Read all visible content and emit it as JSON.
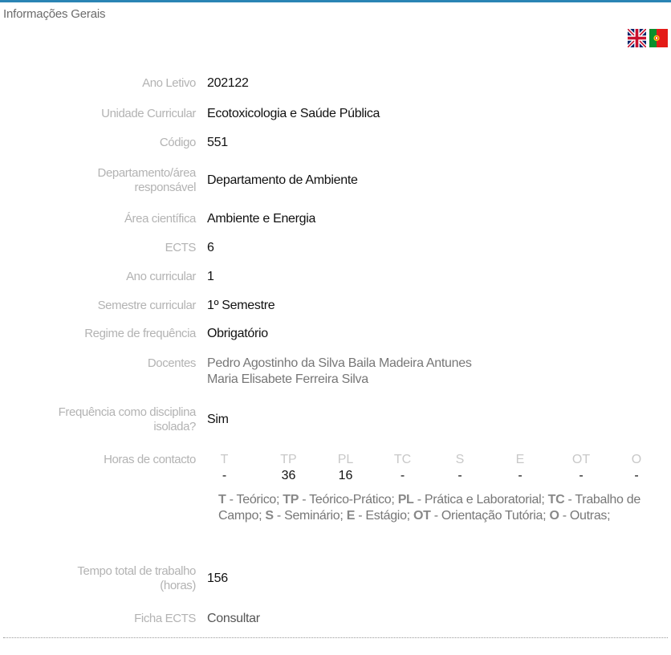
{
  "section_title": "Informações Gerais",
  "languages": [
    {
      "icon": "uk-flag-icon"
    },
    {
      "icon": "portugal-flag-icon"
    }
  ],
  "fields": {
    "ano_letivo": {
      "label": "Ano Letivo",
      "value": "202122"
    },
    "unidade_curricular": {
      "label": "Unidade Curricular",
      "value": "Ecotoxicologia e Saúde Pública"
    },
    "codigo": {
      "label": "Código",
      "value": "551"
    },
    "departamento": {
      "label_line1": "Departamento/área",
      "label_line2": "responsável",
      "value": "Departamento de Ambiente"
    },
    "area_cientifica": {
      "label": "Área científica",
      "value": "Ambiente e Energia"
    },
    "ects": {
      "label": "ECTS",
      "value": "6"
    },
    "ano_curricular": {
      "label": "Ano curricular",
      "value": "1"
    },
    "semestre": {
      "label": "Semestre curricular",
      "value": "1º Semestre"
    },
    "regime": {
      "label": "Regime de frequência",
      "value": "Obrigatório"
    },
    "docentes": {
      "label": "Docentes",
      "values": [
        "Pedro Agostinho da Silva Baila Madeira Antunes",
        "Maria Elisabete Ferreira Silva"
      ]
    },
    "isolada": {
      "label_line1": "Frequência como disciplina",
      "label_line2": "isolada?",
      "value": "Sim"
    },
    "horas": {
      "label": "Horas de contacto",
      "headers": [
        "T",
        "TP",
        "PL",
        "TC",
        "S",
        "E",
        "OT",
        "O"
      ],
      "values": [
        "-",
        "36",
        "16",
        "-",
        "-",
        "-",
        "-",
        "-"
      ],
      "legend": [
        {
          "abbr": "T",
          "text": " - Teórico; "
        },
        {
          "abbr": "TP",
          "text": " - Teórico-Prático; "
        },
        {
          "abbr": "PL",
          "text": " - Prática e Laboratorial; "
        },
        {
          "abbr": "TC",
          "text": " - Trabalho de Campo; "
        },
        {
          "abbr": "S",
          "text": " - Seminário; "
        },
        {
          "abbr": "E",
          "text": " - Estágio; "
        },
        {
          "abbr": "OT",
          "text": " - Orientação Tutória; "
        },
        {
          "abbr": "O",
          "text": " - Outras;"
        }
      ]
    },
    "tempo_total": {
      "label_line1": "Tempo total de trabalho",
      "label_line2": "(horas)",
      "value": "156"
    },
    "ficha_ects": {
      "label": "Ficha ECTS",
      "link": "Consultar"
    }
  }
}
